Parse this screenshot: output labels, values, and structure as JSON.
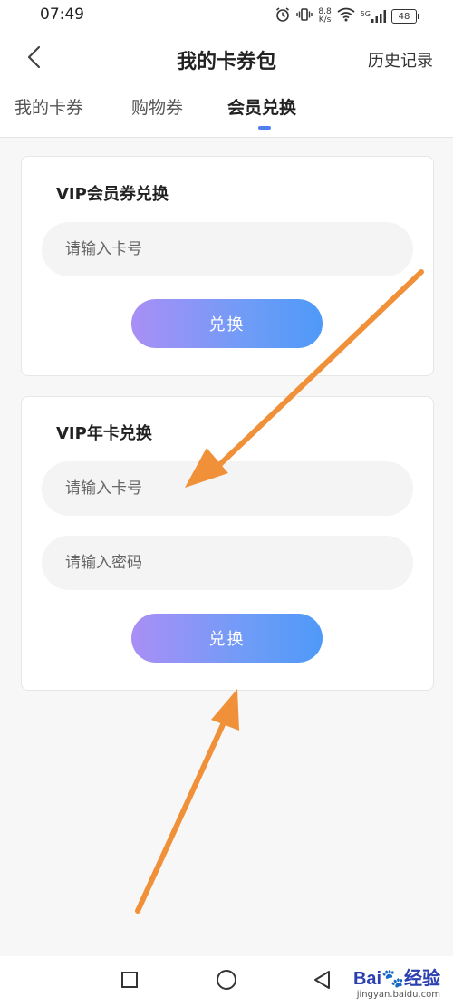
{
  "status_bar": {
    "time": "07:49",
    "net_speed_value": "8.8",
    "net_speed_unit": "K/s",
    "signal_label": "5G",
    "battery": "48"
  },
  "header": {
    "title": "我的卡券包",
    "history_label": "历史记录"
  },
  "tabs": [
    {
      "label": "我的卡券",
      "active": false
    },
    {
      "label": "购物券",
      "active": false
    },
    {
      "label": "会员兑换",
      "active": true
    }
  ],
  "vip_coupon_card": {
    "title": "VIP会员券兑换",
    "card_number_placeholder": "请输入卡号",
    "button_label": "兑换"
  },
  "vip_annual_card": {
    "title": "VIP年卡兑换",
    "card_number_placeholder": "请输入卡号",
    "password_placeholder": "请输入密码",
    "button_label": "兑换"
  },
  "colors": {
    "accent": "#4f7ef0",
    "button_gradient_start": "#a98ff5",
    "button_gradient_end": "#4f99f8",
    "annotation_arrow": "#f0913a"
  },
  "watermark": {
    "brand_prefix": "Bai",
    "brand_suffix": "经验",
    "url": "jingyan.baidu.com"
  }
}
